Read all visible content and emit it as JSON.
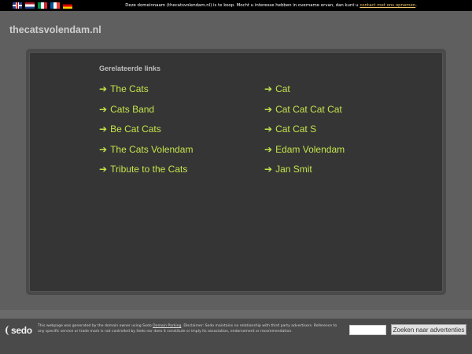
{
  "top_bar": {
    "languages": [
      "en",
      "nl",
      "it",
      "fr",
      "de"
    ],
    "message": "Deze domeinnaam (thecatsvolendam.nl) is te koop. Mocht u interesse hebben in overname ervan, dan kunt u ",
    "contact_link": "contact met ons opnemen",
    "message_end": "."
  },
  "header": {
    "domain": "thecatsvolendam.nl"
  },
  "main": {
    "heading": "Gerelateerde links",
    "arrow": "➔",
    "left_links": [
      "The Cats",
      "Cats Band",
      "Be Cat Cats",
      "The Cats Volendam",
      "Tribute to the Cats"
    ],
    "right_links": [
      "Cat",
      "Cat Cat Cat Cat",
      "Cat Cat S",
      "Edam Volendam",
      "Jan Smit"
    ]
  },
  "footer": {
    "logo": "sedo",
    "disclaimer_pre": "This webpage was generated by the domain owner using Sedo ",
    "disclaimer_link": "Domain Parking",
    "disclaimer_post": ". Disclaimer: Sedo maintains no relationship with third party advertisers. Reference to any specific service or trade mark is not controlled by Sedo nor does it constitute or imply its association, endorsement or recommendation.",
    "search_value": "",
    "search_button": "Zoeken naar advertenties"
  },
  "colors": {
    "background": "#5f5f5f",
    "panel": "#353535",
    "link": "#c3e44c",
    "contact_link": "#f0c36d"
  }
}
